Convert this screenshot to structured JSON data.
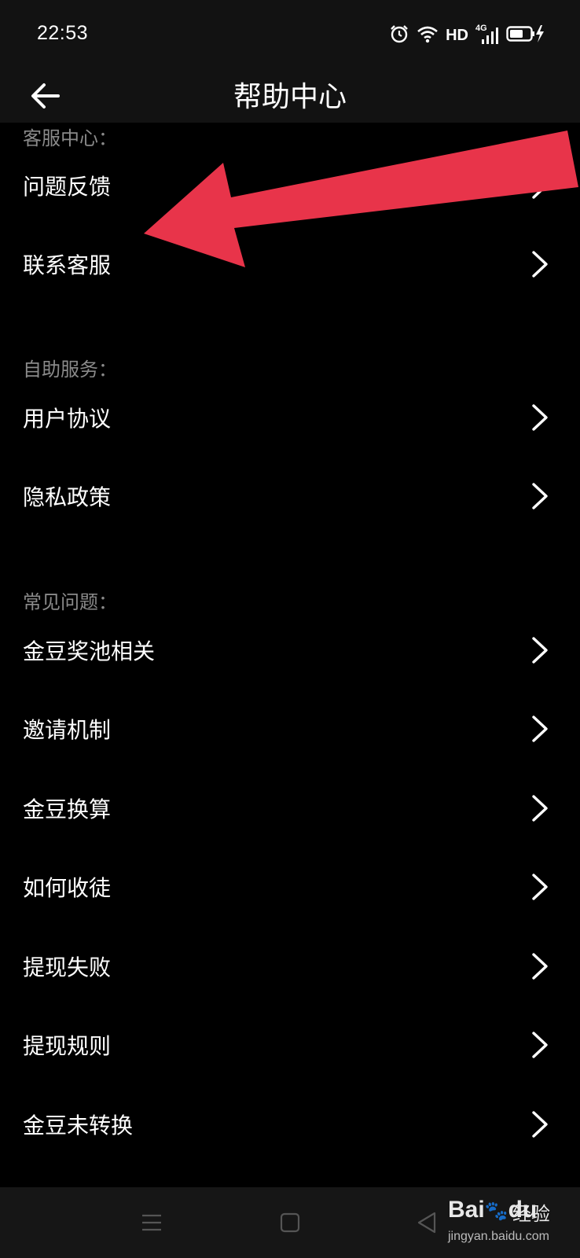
{
  "status_bar": {
    "time": "22:53",
    "network_label": "HD",
    "cell_label": "4G"
  },
  "header": {
    "title": "帮助中心",
    "back_icon": "arrow-left-icon"
  },
  "sections": [
    {
      "heading": "客服中心：",
      "items": [
        {
          "label": "问题反馈"
        },
        {
          "label": "联系客服"
        }
      ]
    },
    {
      "heading": "自助服务：",
      "items": [
        {
          "label": "用户协议"
        },
        {
          "label": "隐私政策"
        }
      ]
    },
    {
      "heading": "常见问题：",
      "items": [
        {
          "label": "金豆奖池相关"
        },
        {
          "label": "邀请机制"
        },
        {
          "label": "金豆换算"
        },
        {
          "label": "如何收徒"
        },
        {
          "label": "提现失败"
        },
        {
          "label": "提现规则"
        },
        {
          "label": "金豆未转换"
        }
      ]
    }
  ],
  "annotation": {
    "arrow_color": "#e8344a"
  },
  "watermark": {
    "logo_text": "Bai",
    "logo_suffix": "du",
    "jingyan": "经验",
    "url": "jingyan.baidu.com"
  },
  "colors": {
    "background": "#000000",
    "bar_background": "#121212",
    "section_heading": "#8a8a8a",
    "text": "#ffffff"
  }
}
